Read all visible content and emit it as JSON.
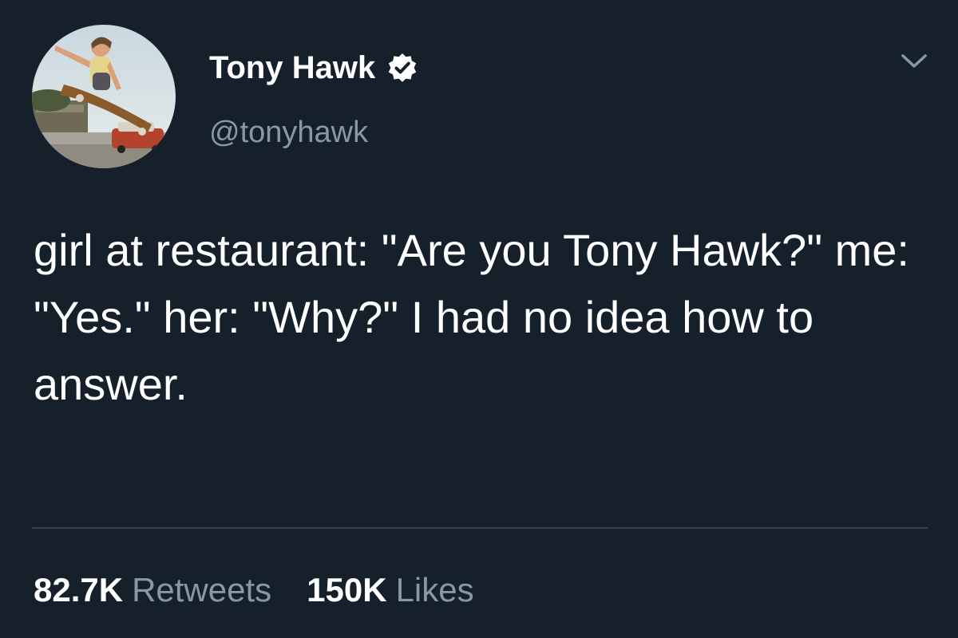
{
  "tweet": {
    "author": {
      "display_name": "Tony Hawk",
      "handle": "@tonyhawk",
      "verified": true,
      "avatar": "skateboarder-jump-photo"
    },
    "text": "girl at restaurant: \"Are you Tony Hawk?\" me: \"Yes.\" her: \"Why?\" I had no idea how to answer.",
    "stats": {
      "retweets_count": "82.7K",
      "retweets_label": "Retweets",
      "likes_count": "150K",
      "likes_label": "Likes"
    },
    "menu_icon": "chevron-down-icon"
  },
  "theme": {
    "background": "#15202b",
    "text": "#ffffff",
    "secondary_text": "#8899a6",
    "divider": "#38444d"
  }
}
